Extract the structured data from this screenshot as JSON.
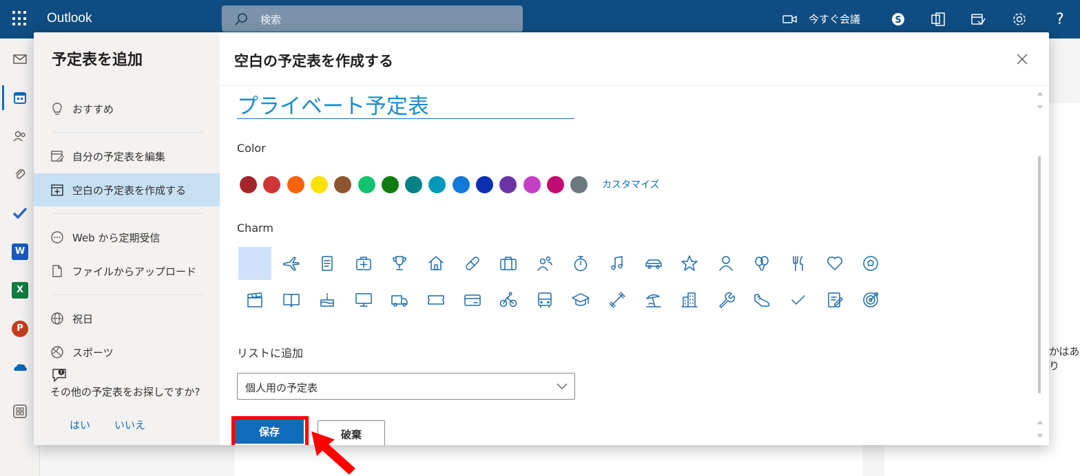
{
  "topbar": {
    "app_name": "Outlook",
    "search_placeholder": "検索",
    "meet_now": "今すぐ会議"
  },
  "modal": {
    "left_title": "予定表を追加",
    "nav": [
      {
        "label": "おすすめ",
        "icon": "lightbulb-icon"
      },
      {
        "label": "自分の予定表を編集",
        "icon": "edit-calendar-icon"
      },
      {
        "label": "空白の予定表を作成する",
        "icon": "calendar-add-icon",
        "selected": true
      },
      {
        "label": "Web から定期受信",
        "icon": "more-circle-icon"
      },
      {
        "label": "ファイルからアップロード",
        "icon": "file-upload-icon"
      },
      {
        "label": "祝日",
        "icon": "globe-icon"
      },
      {
        "label": "スポーツ",
        "icon": "sports-ball-icon"
      }
    ],
    "feedback": {
      "question": "その他の予定表をお探しですか?",
      "yes": "はい",
      "no": "いいえ"
    },
    "title": "空白の予定表を作成する",
    "calendar_name": "プライベート予定表",
    "color_label": "Color",
    "colors": [
      "#a4262c",
      "#d13438",
      "#f7630c",
      "#fce100",
      "#8e562e",
      "#10c46f",
      "#107c10",
      "#038387",
      "#0099bc",
      "#0f7ad8",
      "#0b2fb0",
      "#6b34a5",
      "#c53fc6",
      "#c30c73",
      "#69797e"
    ],
    "customize_label": "カスタマイズ",
    "charm_label": "Charm",
    "charms_row1": [
      "none",
      "airplane-icon",
      "notepad-icon",
      "first-aid-icon",
      "trophy-icon",
      "home-icon",
      "bandage-icon",
      "briefcase-icon",
      "people-icon",
      "stopwatch-icon",
      "music-icon",
      "car-icon",
      "star-icon",
      "person-icon",
      "balloon-icon",
      "fork-knife-icon",
      "heart-icon",
      "soccer-icon"
    ],
    "charms_row2": [
      "clapperboard-icon",
      "book-icon",
      "cake-icon",
      "monitor-icon",
      "truck-icon",
      "ticket-icon",
      "wallet-icon",
      "cyclist-icon",
      "bus-icon",
      "graduation-cap-icon",
      "dumbbell-icon",
      "beach-icon",
      "building-icon",
      "wrench-icon",
      "sneaker-icon",
      "checkmark-icon",
      "notes-icon",
      "target-icon"
    ],
    "list_label": "リストに追加",
    "list_value": "個人用の予定表",
    "save_label": "保存",
    "discard_label": "破棄"
  },
  "background": {
    "right_text": "かはあり"
  }
}
